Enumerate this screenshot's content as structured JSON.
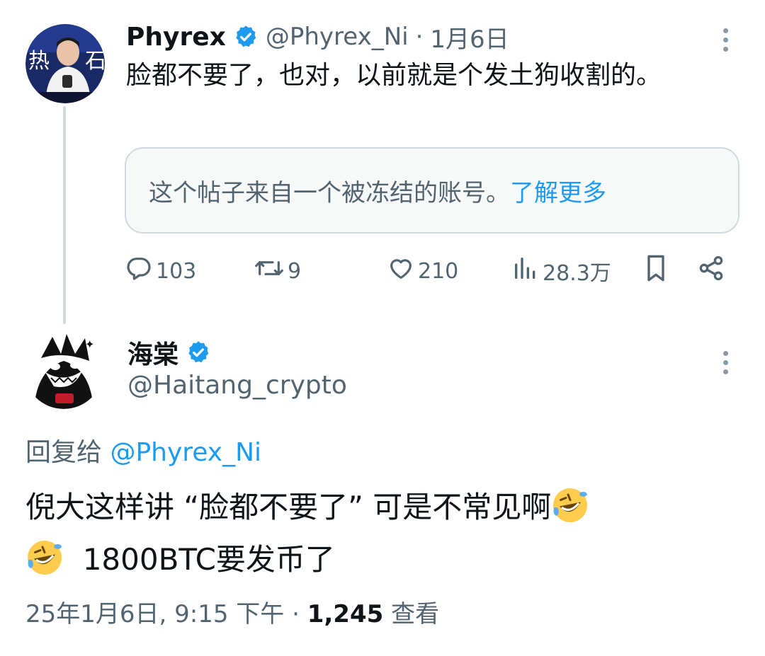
{
  "parent": {
    "name": "Phyrex",
    "handle": "@Phyrex_Ni",
    "separator": "·",
    "date": "1月6日",
    "text": "脸都不要了，也对，以前就是个发土狗收割的。",
    "notice": {
      "text": "这个帖子来自一个被冻结的账号。",
      "link": "了解更多"
    },
    "stats": {
      "replies": "103",
      "reposts": "9",
      "likes": "210",
      "views": "28.3万"
    }
  },
  "reply": {
    "name": "海棠",
    "handle": "@Haitang_crypto",
    "replying_prefix": "回复给 ",
    "replying_to": "@Phyrex_Ni",
    "text_part1": "倪大这样讲 “脸都不要了” 可是不常见啊",
    "text_part2": "1800BTC要发币了",
    "timestamp": "25年1月6日, 9:15 下午 · ",
    "views_count": "1,245",
    "views_label": " 查看"
  },
  "icons": {
    "verified": "verified-badge-icon",
    "more": "more-vertical-icon",
    "reply": "reply-bubble-icon",
    "repost": "repost-icon",
    "like": "heart-icon",
    "views": "views-chart-icon",
    "bookmark": "bookmark-icon",
    "share": "share-icon",
    "emoji": "rolling-on-floor-laughing-emoji"
  },
  "colors": {
    "accent": "#1d9bf0",
    "text": "#0f1419",
    "secondary": "#536471",
    "border": "#cfd9de"
  }
}
